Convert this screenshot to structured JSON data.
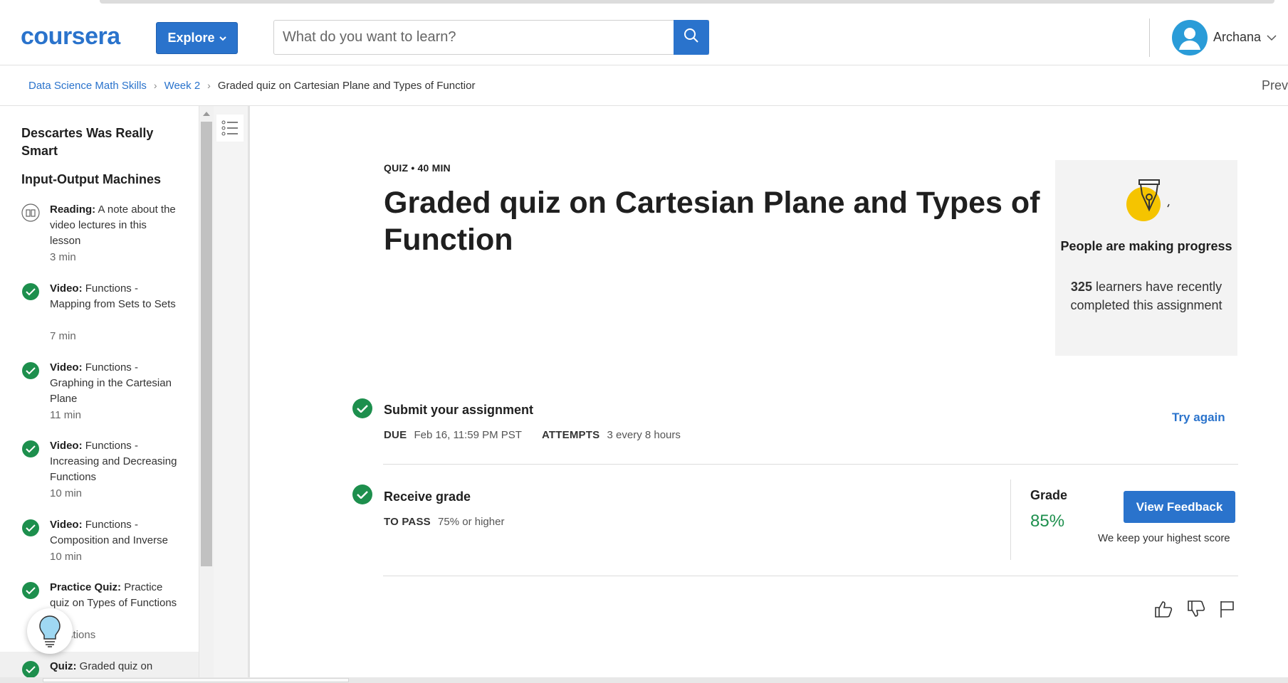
{
  "header": {
    "logo": "coursera",
    "explore_label": "Explore",
    "search_placeholder": "What do you want to learn?",
    "user_name": "Archana"
  },
  "breadcrumb": {
    "items": [
      "Data Science Math Skills",
      "Week 2"
    ],
    "current": "Graded quiz on Cartesian Plane and Types of Functior",
    "prev_label": "Prev"
  },
  "sidebar": {
    "section_title": "Descartes Was Really Smart",
    "lesson_title": "Input-Output Machines",
    "items": [
      {
        "type": "Reading:",
        "title": "A note about the video lectures in this lesson",
        "duration": "3 min",
        "status": "reading"
      },
      {
        "type": "Video:",
        "title": "Functions - Mapping from Sets to Sets",
        "duration": "7 min",
        "status": "done"
      },
      {
        "type": "Video:",
        "title": "Functions - Graphing in the Cartesian Plane",
        "duration": "11 min",
        "status": "done"
      },
      {
        "type": "Video:",
        "title": "Functions - Increasing and Decreasing Functions",
        "duration": "10 min",
        "status": "done"
      },
      {
        "type": "Video:",
        "title": "Functions - Composition and Inverse",
        "duration": "10 min",
        "status": "done"
      },
      {
        "type": "Practice Quiz:",
        "title": "Practice quiz on Types of Functions",
        "duration": "questions",
        "status": "done"
      },
      {
        "type": "Quiz:",
        "title": "Graded quiz on",
        "duration": "",
        "status": "done"
      }
    ]
  },
  "main": {
    "kicker": "QUIZ • 40 MIN",
    "title": "Graded quiz on Cartesian Plane and Types of Function",
    "progress_card": {
      "title": "People are making progress",
      "count": "325",
      "body": "learners have recently completed this assignment"
    },
    "submit": {
      "title": "Submit your assignment",
      "due_label": "DUE",
      "due_value": "Feb 16, 11:59 PM PST",
      "attempts_label": "ATTEMPTS",
      "attempts_value": "3 every 8 hours",
      "try_again": "Try again"
    },
    "receive": {
      "title": "Receive grade",
      "to_pass_label": "TO PASS",
      "to_pass_value": "75% or higher",
      "grade_label": "Grade",
      "grade_value": "85%",
      "view_feedback": "View Feedback",
      "keep_note": "We keep your highest score"
    }
  },
  "colors": {
    "brand": "#2a73cc",
    "success": "#1d8f4d",
    "card_bg": "#f3f3f3"
  }
}
